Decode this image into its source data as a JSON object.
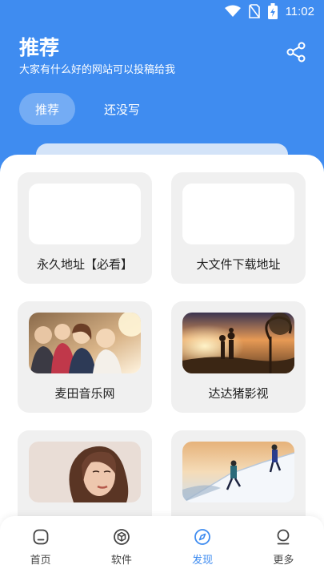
{
  "status_bar": {
    "time": "11:02",
    "icons": [
      "wifi-icon",
      "no-sim-icon",
      "battery-charging-icon"
    ]
  },
  "header": {
    "title": "推荐",
    "subtitle": "大家有什么好的网站可以投稿给我",
    "share_icon": "share-icon"
  },
  "tabs": [
    {
      "label": "推荐",
      "active": true
    },
    {
      "label": "还没写",
      "active": false
    }
  ],
  "cards": [
    {
      "label": "永久地址【必看】",
      "image": "blank"
    },
    {
      "label": "大文件下载地址",
      "image": "blank"
    },
    {
      "label": "麦田音乐网",
      "image": "friends-photo"
    },
    {
      "label": "达达猪影视",
      "image": "sunset-couple-photo"
    },
    {
      "label": "",
      "image": "woman-portrait-photo"
    },
    {
      "label": "",
      "image": "mountain-climbers-photo"
    }
  ],
  "bottom_nav": [
    {
      "label": "首页",
      "icon": "home-icon",
      "active": false
    },
    {
      "label": "软件",
      "icon": "box-icon",
      "active": false
    },
    {
      "label": "发现",
      "icon": "compass-icon",
      "active": true
    },
    {
      "label": "更多",
      "icon": "profile-icon",
      "active": false
    }
  ],
  "colors": {
    "primary": "#3f8cf0",
    "card_bg": "#f0f0f0"
  }
}
